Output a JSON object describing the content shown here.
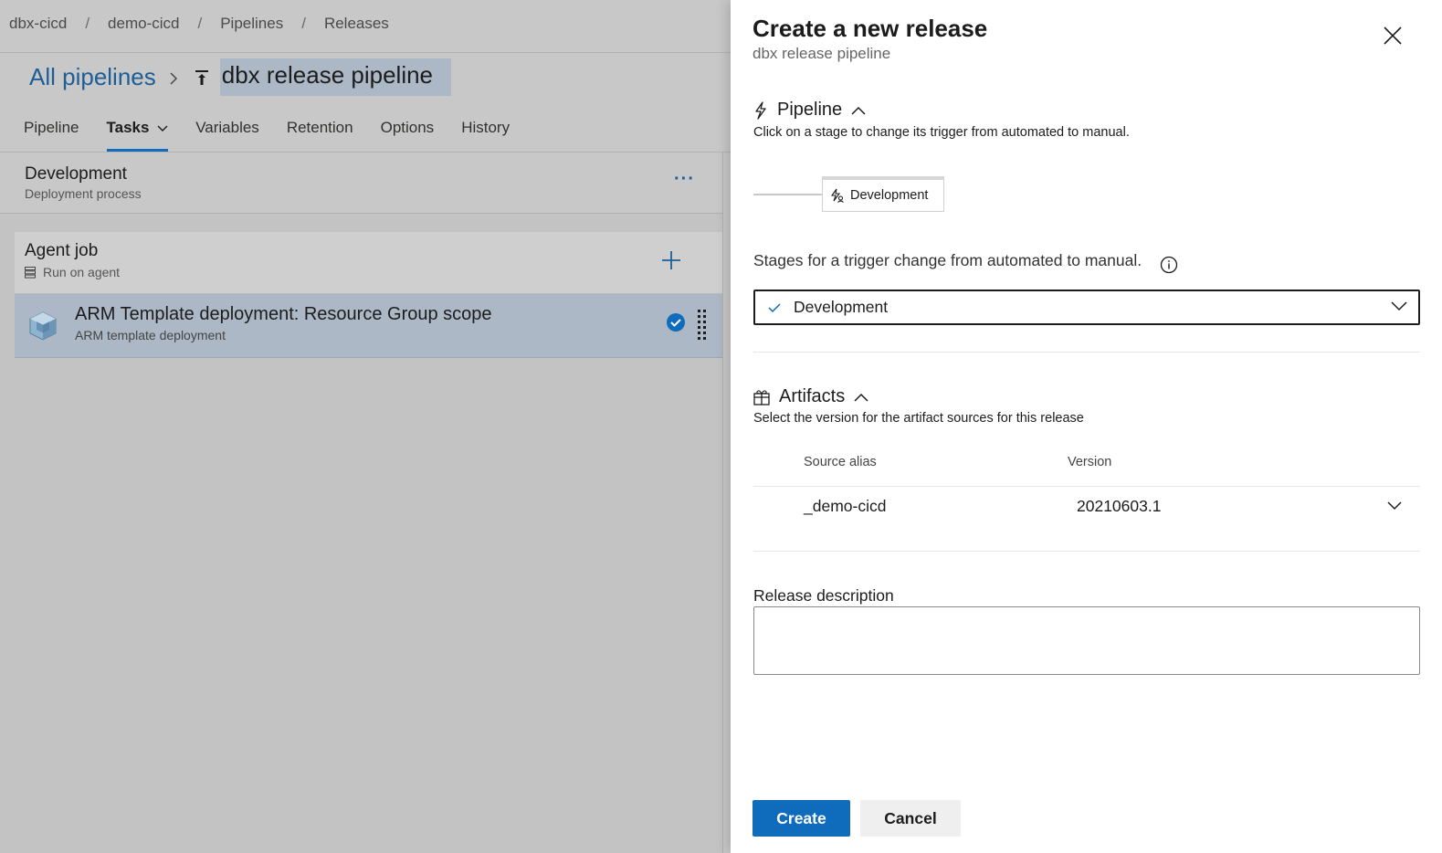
{
  "breadcrumb": [
    "dbx-cicd",
    "demo-cicd",
    "Pipelines",
    "Releases"
  ],
  "breadcrumb_separator": "/",
  "header": {
    "all_pipelines": "All pipelines",
    "pipeline_name": "dbx release pipeline"
  },
  "tabs": [
    {
      "label": "Pipeline"
    },
    {
      "label": "Tasks"
    },
    {
      "label": "Variables"
    },
    {
      "label": "Retention"
    },
    {
      "label": "Options"
    },
    {
      "label": "History"
    }
  ],
  "stage": {
    "title": "Development",
    "subtitle": "Deployment process",
    "more": "···"
  },
  "agent_job": {
    "title": "Agent job",
    "subtitle": "Run on agent"
  },
  "task": {
    "title": "ARM Template deployment: Resource Group scope",
    "subtitle": "ARM template deployment"
  },
  "panel": {
    "title": "Create a new release",
    "subtitle": "dbx release pipeline",
    "pipeline_section": {
      "heading": "Pipeline",
      "description": "Click on a stage to change its trigger from automated to manual.",
      "stage_label": "Development"
    },
    "stages_trigger_label": "Stages for a trigger change from automated to manual.",
    "stages_selected": "Development",
    "artifacts_section": {
      "heading": "Artifacts",
      "description": "Select the version for the artifact sources for this release",
      "col_source_alias": "Source alias",
      "col_version": "Version",
      "rows": [
        {
          "alias": "_demo-cicd",
          "version": "20210603.1"
        }
      ]
    },
    "release_description_label": "Release description",
    "release_description_value": "",
    "create_label": "Create",
    "cancel_label": "Cancel"
  },
  "colors": {
    "accent": "#0f6cbd",
    "link": "#1d5e96",
    "overlay_bg": "#c8c8c8",
    "selection": "#adb8c6"
  }
}
